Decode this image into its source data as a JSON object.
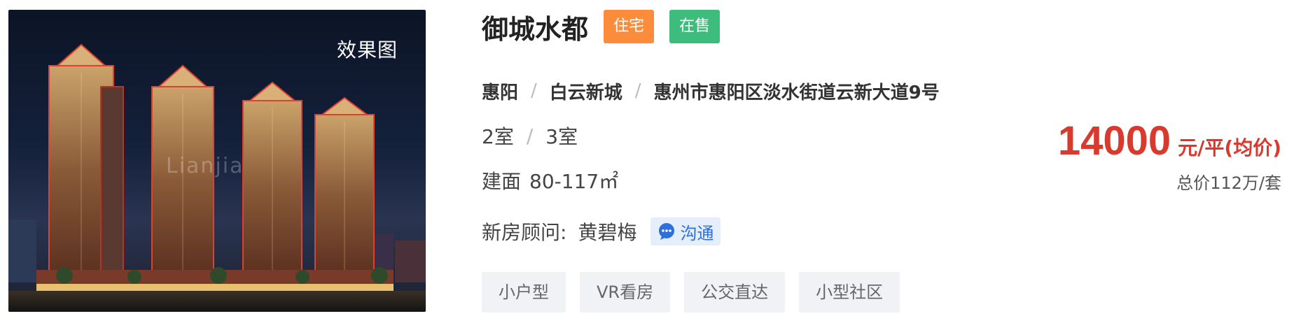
{
  "photo": {
    "label": "效果图",
    "watermark": "Lianjia"
  },
  "listing": {
    "title": "御城水都",
    "tags": [
      "住宅",
      "在售"
    ],
    "location": {
      "city": "惠阳",
      "district": "白云新城",
      "address": "惠州市惠阳区淡水街道云新大道9号"
    },
    "rooms": [
      "2室",
      "3室"
    ],
    "area": {
      "label": "建面",
      "value": "80-117㎡"
    },
    "advisor": {
      "label": "新房顾问:",
      "name": "黄碧梅",
      "chat_label": "沟通"
    },
    "features": [
      "小户型",
      "VR看房",
      "公交直达",
      "小型社区"
    ],
    "price": {
      "value": "14000",
      "unit": "元/平(均价)",
      "total": "总价112万/套"
    }
  },
  "colors": {
    "tag_orange": "#fb8c3c",
    "tag_green": "#3ebc7c",
    "price_red": "#d83a2e",
    "chat_blue": "#2f6fd9"
  },
  "icons": {
    "chat": "chat-bubble-icon"
  }
}
